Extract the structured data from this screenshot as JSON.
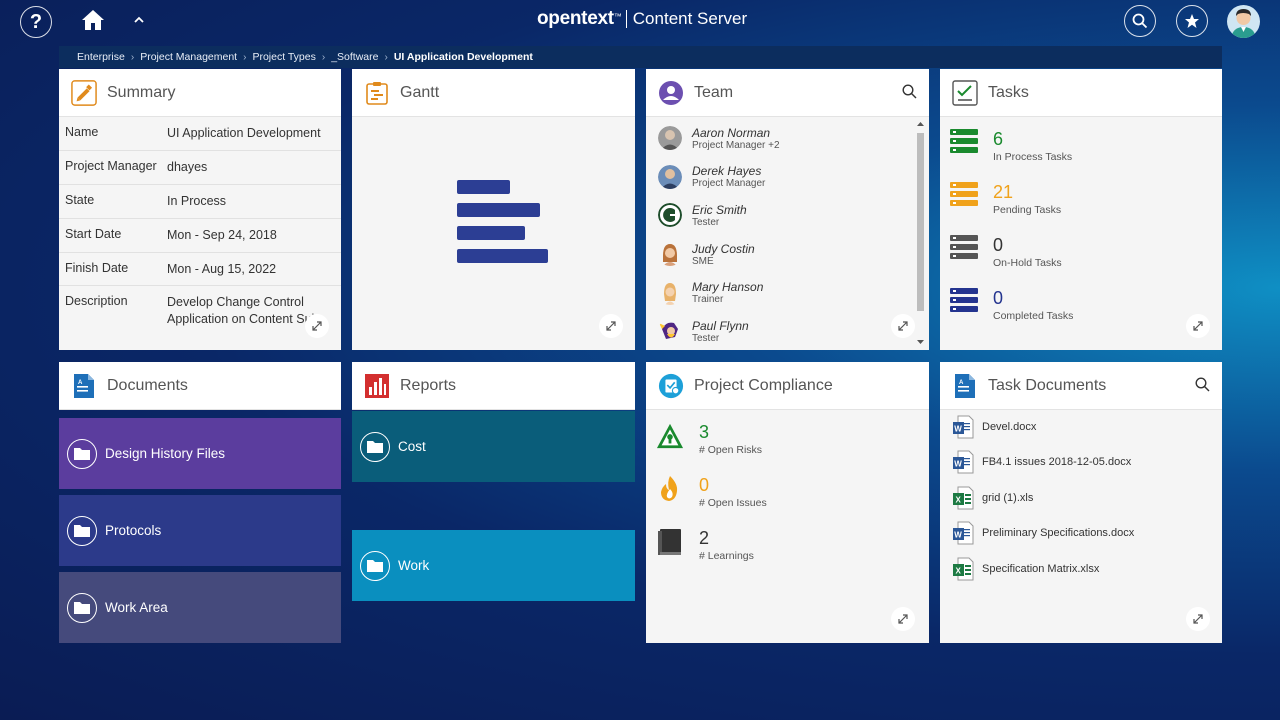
{
  "header": {
    "brand_logo": "opentext",
    "brand_tm": "™",
    "brand_product": "Content Server"
  },
  "breadcrumb": {
    "items": [
      "Enterprise",
      "Project Management",
      "Project Types",
      "_Software"
    ],
    "current": "UI Application Development"
  },
  "summary": {
    "title": "Summary",
    "rows": [
      {
        "key": "Name",
        "value": "UI Application Development"
      },
      {
        "key": "Project Manager",
        "value": "dhayes"
      },
      {
        "key": "State",
        "value": "In Process"
      },
      {
        "key": "Start Date",
        "value": "Mon - Sep 24, 2018"
      },
      {
        "key": "Finish Date",
        "value": "Mon - Aug 15, 2022"
      },
      {
        "key": "Description",
        "value": "Develop Change Control Application on Content Suite"
      }
    ]
  },
  "gantt": {
    "title": "Gantt"
  },
  "team": {
    "title": "Team",
    "members": [
      {
        "name": "Aaron Norman",
        "role": "Project Manager",
        "extra": "+2"
      },
      {
        "name": "Derek Hayes",
        "role": "Project Manager",
        "extra": ""
      },
      {
        "name": "Eric Smith",
        "role": "Tester",
        "extra": ""
      },
      {
        "name": "Judy Costin",
        "role": "SME",
        "extra": ""
      },
      {
        "name": "Mary Hanson",
        "role": "Trainer",
        "extra": ""
      },
      {
        "name": "Paul Flynn",
        "role": "Tester",
        "extra": ""
      }
    ]
  },
  "tasks": {
    "title": "Tasks",
    "items": [
      {
        "count": "6",
        "label": "In Process Tasks",
        "color": "#1a8a2e"
      },
      {
        "count": "21",
        "label": "Pending Tasks",
        "color": "#f0a21b"
      },
      {
        "count": "0",
        "label": "On-Hold Tasks",
        "color": "#333333"
      },
      {
        "count": "0",
        "label": "Completed Tasks",
        "color": "#24348f"
      }
    ]
  },
  "documents": {
    "title": "Documents",
    "folders": [
      {
        "label": "Design History Files",
        "color": "#5b3d9e"
      },
      {
        "label": "Protocols",
        "color": "#2c3a8a"
      },
      {
        "label": "Work Area",
        "color": "#454a7c"
      }
    ]
  },
  "reports": {
    "title": "Reports",
    "folders": [
      {
        "label": "Cost",
        "color": "#0a5d7a"
      },
      {
        "label": "Work",
        "color": "#0a8fbf"
      }
    ]
  },
  "compliance": {
    "title": "Project Compliance",
    "items": [
      {
        "count": "3",
        "label": "# Open Risks",
        "color": "#1a8a2e"
      },
      {
        "count": "0",
        "label": "# Open Issues",
        "color": "#f0a21b"
      },
      {
        "count": "2",
        "label": "# Learnings",
        "color": "#333333"
      }
    ]
  },
  "task_documents": {
    "title": "Task Documents",
    "files": [
      {
        "name": "Devel.docx",
        "type": "word"
      },
      {
        "name": "FB4.1 issues 2018-12-05.docx",
        "type": "word"
      },
      {
        "name": "grid (1).xls",
        "type": "excel"
      },
      {
        "name": "Preliminary Specifications.docx",
        "type": "word"
      },
      {
        "name": "Specification Matrix.xlsx",
        "type": "excel"
      }
    ]
  },
  "colors": {
    "accent_blue": "#24348f",
    "word_blue": "#2b5797",
    "excel_green": "#1d7a43"
  },
  "icons": [
    "help-icon",
    "home-icon",
    "chevron-up-icon",
    "search-icon",
    "star-icon",
    "user-avatar",
    "expand-icon",
    "folder-icon",
    "word-doc-icon",
    "excel-doc-icon"
  ]
}
